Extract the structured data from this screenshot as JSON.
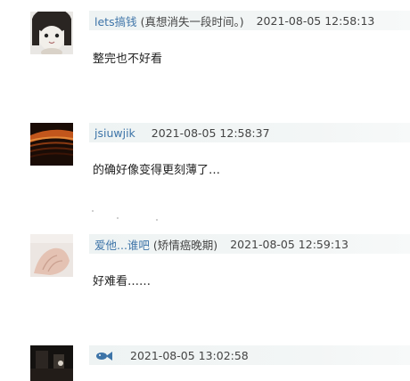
{
  "comments": [
    {
      "username": "lets搞钱",
      "note": "(真想消失一段时间。)",
      "timestamp": "2021-08-05 12:58:13",
      "text": "整完也不好看",
      "avatar_icon": "cat-avatar-icon"
    },
    {
      "username": "jsiuwjik",
      "note": "",
      "timestamp": "2021-08-05 12:58:37",
      "text": "的确好像变得更刻薄了…",
      "avatar_icon": "sunset-curves-avatar-icon"
    },
    {
      "username": "爱他...谁吧",
      "note": "(矫情癌晚期)",
      "timestamp": "2021-08-05 12:59:13",
      "text": "好难看……",
      "avatar_icon": "hand-avatar-icon"
    },
    {
      "username": "",
      "note": "",
      "timestamp": "2021-08-05 13:02:58",
      "text": "",
      "avatar_icon": "dark-cafe-avatar-icon"
    }
  ],
  "colors": {
    "username": "#3d74a8",
    "header_bg": "#eef3f3"
  }
}
